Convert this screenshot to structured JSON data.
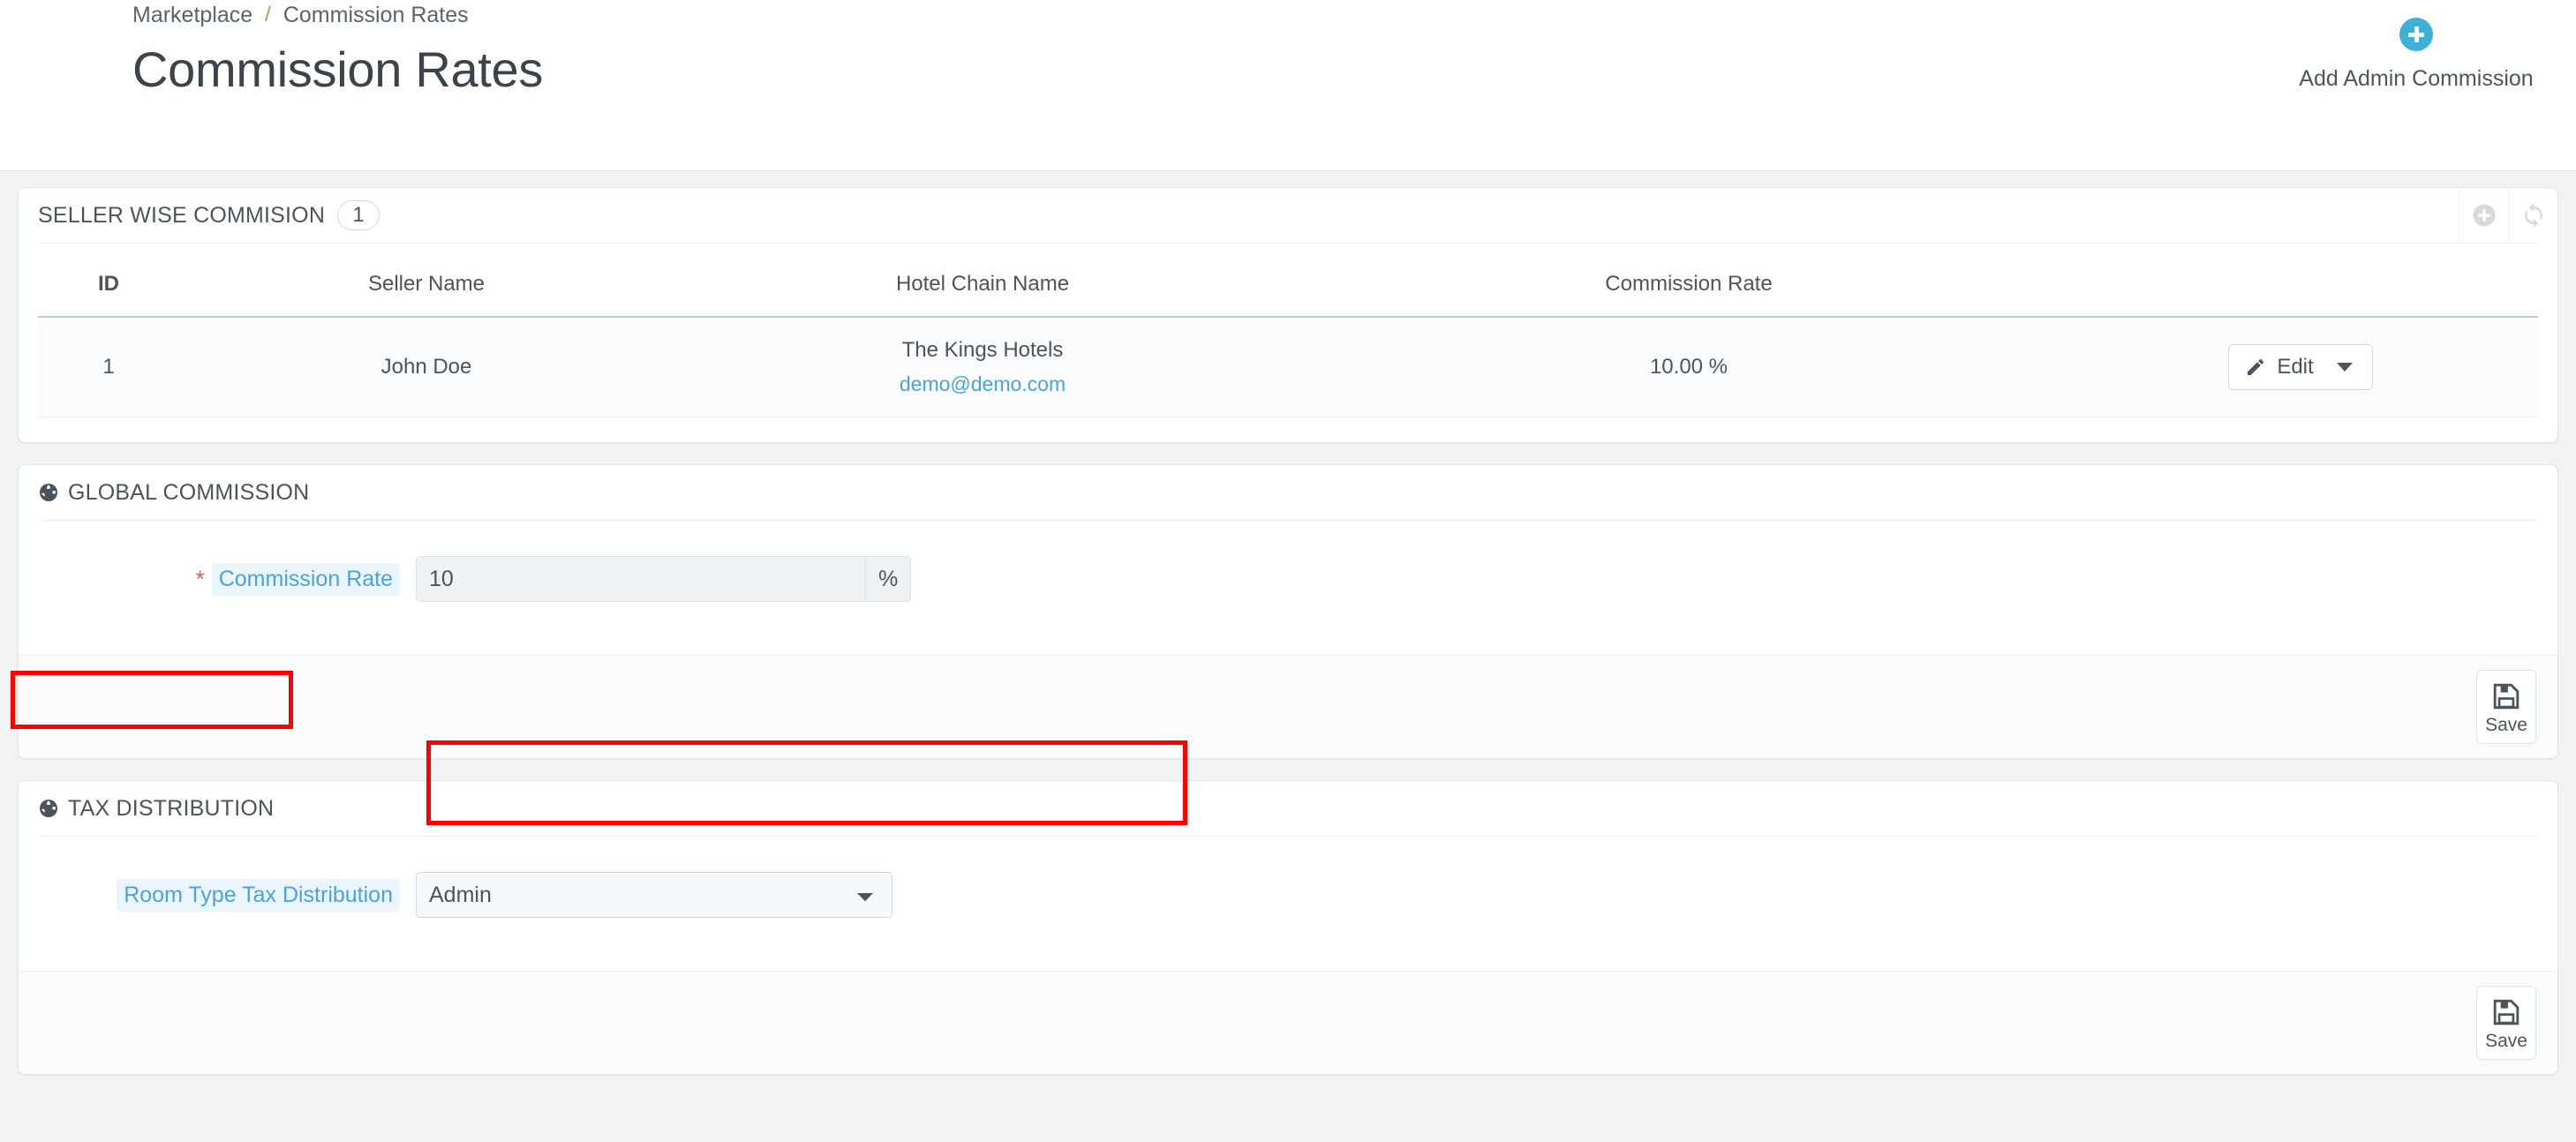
{
  "breadcrumb": {
    "parent": "Marketplace",
    "separator": "/",
    "current": "Commission Rates"
  },
  "page": {
    "title": "Commission Rates"
  },
  "header_action": {
    "label": "Add Admin Commission",
    "icon": "plus-circle-icon",
    "color": "#41b0d6"
  },
  "seller_panel": {
    "title": "SELLER WISE COMMISION",
    "count": "1",
    "tools": [
      {
        "name": "add-icon",
        "glyph": "plus-circle"
      },
      {
        "name": "refresh-icon",
        "glyph": "sync"
      }
    ],
    "columns": [
      "ID",
      "Seller Name",
      "Hotel Chain Name",
      "Commission Rate"
    ],
    "rows": [
      {
        "id": "1",
        "seller_name": "John Doe",
        "hotel_chain_name": "The Kings Hotels",
        "hotel_email": "demo@demo.com",
        "commission_rate": "10.00 %",
        "action_label": "Edit"
      }
    ]
  },
  "global_commission": {
    "title": "GLOBAL COMMISSION",
    "icon": "globe-icon",
    "required_marker": "*",
    "rate_label": "Commission Rate",
    "rate_value": "10",
    "rate_placeholder": "",
    "rate_suffix": "%",
    "save_label": "Save"
  },
  "tax_distribution": {
    "title": "TAX DISTRIBUTION",
    "icon": "globe-icon",
    "field_label": "Room Type Tax Distribution",
    "selected_option": "Admin",
    "options": [
      "Admin"
    ],
    "save_label": "Save"
  },
  "annotations": {
    "highlight_color": "#ff0000",
    "boxes": [
      "global-commission-header",
      "commission-rate-field"
    ]
  }
}
